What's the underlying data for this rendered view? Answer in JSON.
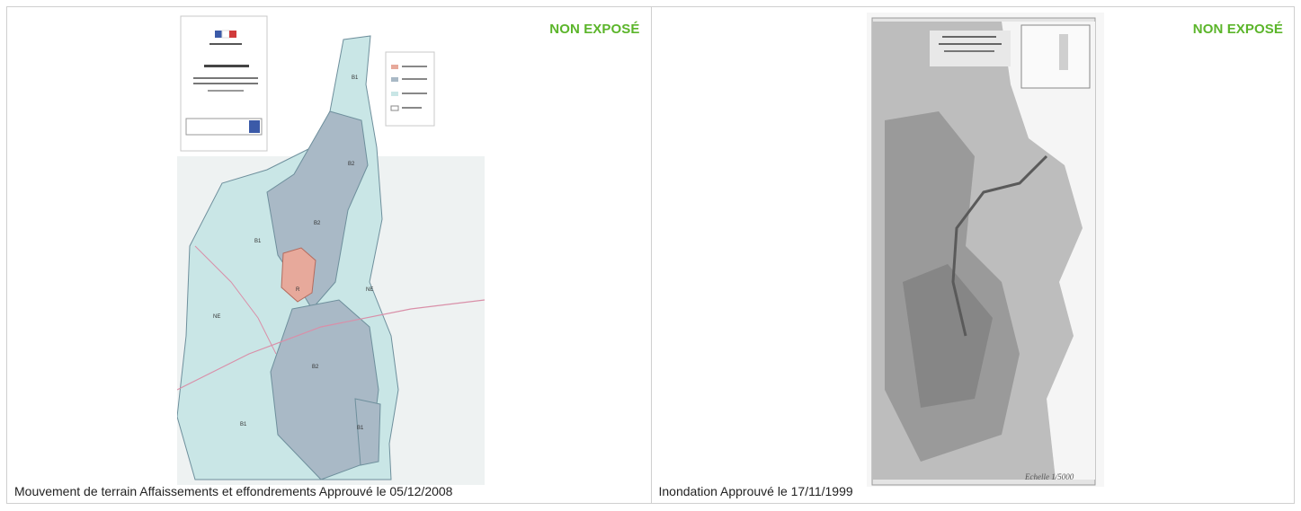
{
  "plans": [
    {
      "badge": "NON EXPOSÉ",
      "caption": "Mouvement de terrain Affaissements et effondrements Approuvé le 05/12/2008"
    },
    {
      "badge": "NON EXPOSÉ",
      "caption": "Inondation Approuvé le 17/11/1999"
    }
  ],
  "colors": {
    "badge": "#5bb52a",
    "zone_blue": "#c9e6e6",
    "zone_grey_blue": "#a9b9c6",
    "zone_red": "#e7a99b"
  }
}
